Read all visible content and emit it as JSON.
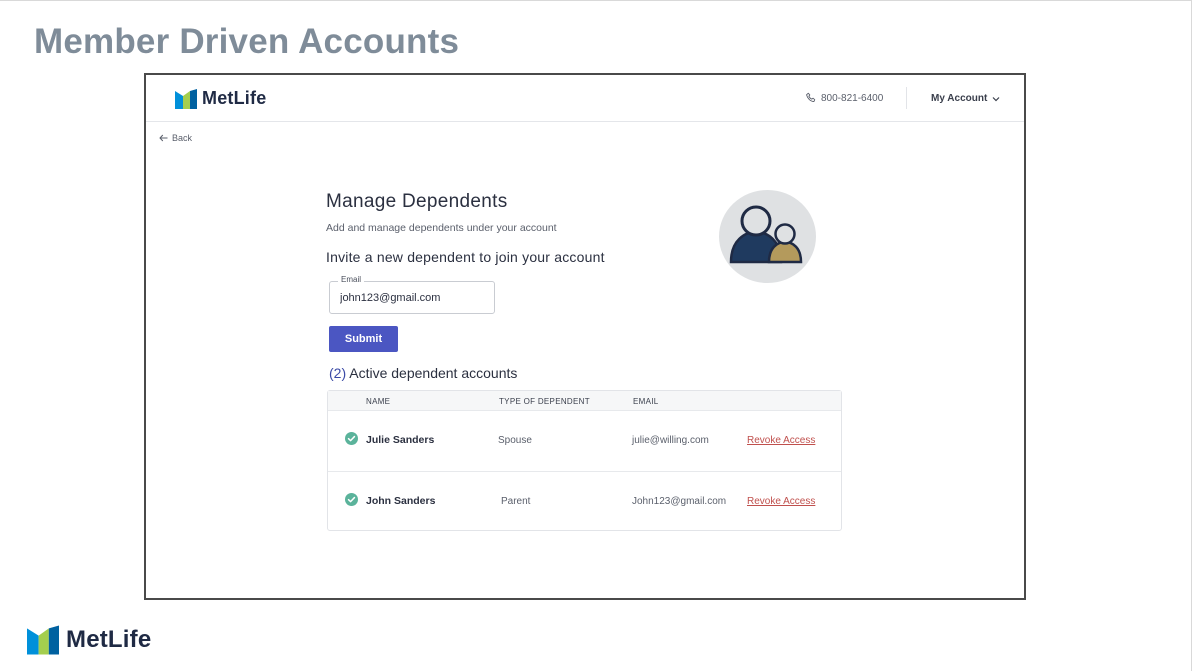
{
  "slide": {
    "title": "Member Driven Accounts"
  },
  "brand": {
    "name": "MetLife",
    "colors": {
      "blue": "#0090da",
      "green": "#a4ce4e",
      "navy": "#1f2a44"
    }
  },
  "header": {
    "phone": "800-821-6400",
    "account_label": "My Account",
    "icons": {
      "phone": "phone-icon",
      "account": "chevron-down-icon"
    }
  },
  "nav": {
    "back_label": "Back"
  },
  "main": {
    "title": "Manage Dependents",
    "subtitle": "Add and manage dependents under your account",
    "invite_heading": "Invite a new dependent to join your account",
    "email_label": "Email",
    "email_value": "john123@gmail.com",
    "submit_label": "Submit",
    "active_count": "(2)",
    "active_heading": "Active dependent accounts",
    "accent_color": "#4b56c2"
  },
  "table": {
    "headers": {
      "name": "NAME",
      "type": "TYPE OF DEPENDENT",
      "email": "EMAIL"
    },
    "rows": [
      {
        "name": "Julie Sanders",
        "type": "Spouse",
        "email": "julie@willing.com",
        "action": "Revoke Access"
      },
      {
        "name": "John Sanders",
        "type": "Parent",
        "email": "John123@gmail.com",
        "action": "Revoke Access"
      }
    ]
  }
}
